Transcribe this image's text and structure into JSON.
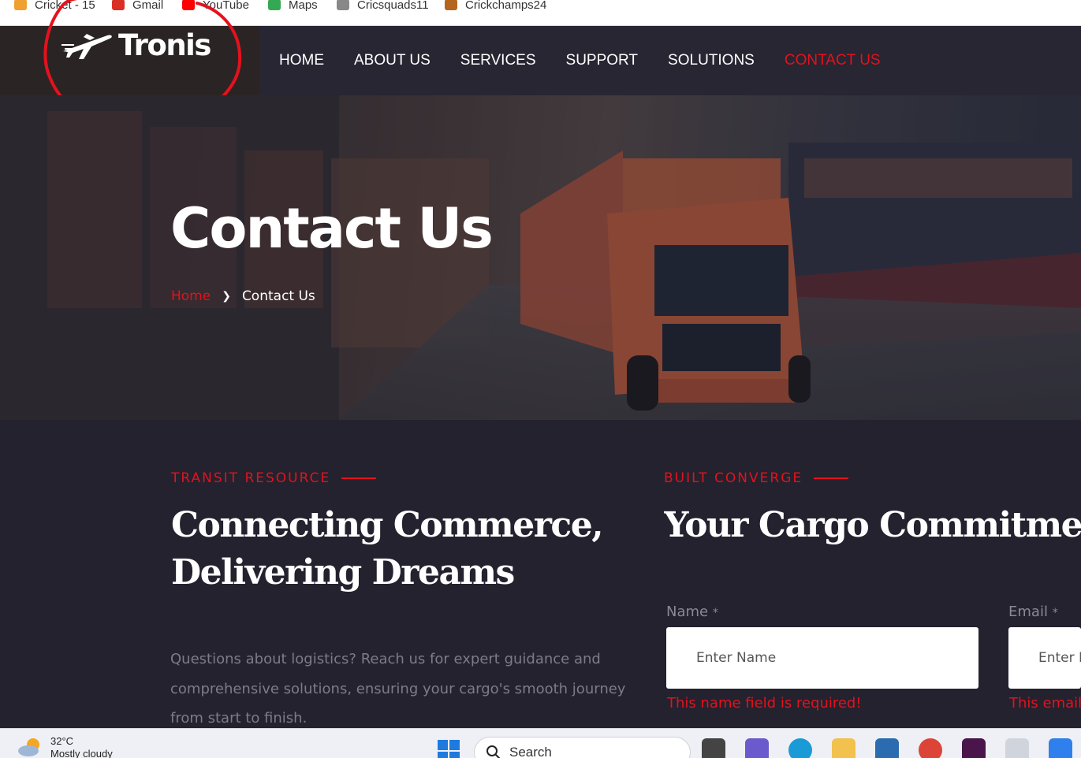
{
  "bookmarks": [
    {
      "label": "Cricket - 15",
      "color": "#f0a030"
    },
    {
      "label": "Gmail",
      "color": "#d93025"
    },
    {
      "label": "YouTube",
      "color": "#ff0000"
    },
    {
      "label": "Maps",
      "color": "#34a853"
    },
    {
      "label": "Cricsquads11",
      "color": "#888888"
    },
    {
      "label": "Crickchamps24",
      "color": "#b5651d"
    }
  ],
  "header": {
    "logo_text": "Tronis",
    "nav": [
      {
        "label": "HOME",
        "active": false
      },
      {
        "label": "ABOUT US",
        "active": false
      },
      {
        "label": "SERVICES",
        "active": false
      },
      {
        "label": "SUPPORT",
        "active": false
      },
      {
        "label": "SOLUTIONS",
        "active": false
      },
      {
        "label": "CONTACT US",
        "active": true
      }
    ]
  },
  "hero": {
    "title": "Contact Us",
    "breadcrumb": {
      "home": "Home",
      "separator_icon": "chevron-right-icon",
      "current": "Contact Us"
    }
  },
  "left_section": {
    "tag": "TRANSIT RESOURCE",
    "heading_line1": "Connecting Commerce,",
    "heading_line2": "Delivering Dreams",
    "paragraph": "Questions about logistics? Reach us for expert guidance and comprehensive solutions, ensuring your cargo's smooth journey from start to finish."
  },
  "right_section": {
    "tag": "BUILT CONVERGE",
    "heading": "Your Cargo Commitment i",
    "form": {
      "name": {
        "label": "Name",
        "required_mark": "*",
        "placeholder": "Enter Name",
        "value": "",
        "error": "This name field is required!"
      },
      "email": {
        "label": "Email",
        "required_mark": "*",
        "placeholder": "Enter E",
        "value": "",
        "error": "This email"
      }
    }
  },
  "taskbar": {
    "weather_temp": "32°C",
    "weather_desc": "Mostly cloudy",
    "search_label": "Search"
  },
  "colors": {
    "accent": "#e3121d",
    "page_bg": "#23222e",
    "header_bg": "#272632"
  }
}
